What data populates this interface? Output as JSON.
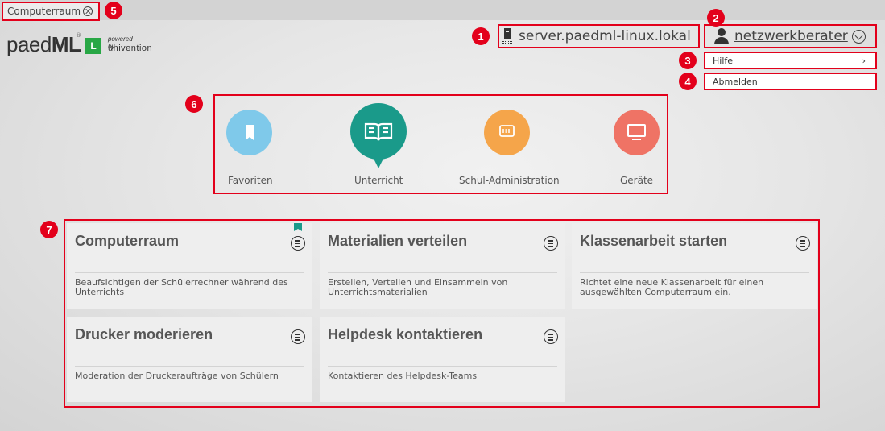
{
  "tab": {
    "label": "Computerraum"
  },
  "annotations": [
    "1",
    "2",
    "3",
    "4",
    "5",
    "6",
    "7"
  ],
  "logo": {
    "name_light": "paed",
    "name_bold": "ML",
    "registered": "®",
    "badge": "L",
    "powered_by": "powered by",
    "vendor": "univention"
  },
  "header": {
    "server": "server.paedml-linux.lokal",
    "user": "netzwerkberater"
  },
  "user_menu": [
    {
      "label": "Hilfe",
      "has_submenu": true
    },
    {
      "label": "Abmelden",
      "has_submenu": false
    }
  ],
  "categories": [
    {
      "label": "Favoriten",
      "color": "#7fc9ea",
      "icon": "bookmark-icon"
    },
    {
      "label": "Unterricht",
      "color": "#1a9a8a",
      "icon": "book-icon",
      "selected": true
    },
    {
      "label": "Schul-Administration",
      "color": "#f5a54a",
      "icon": "calculator-icon"
    },
    {
      "label": "Geräte",
      "color": "#ef7365",
      "icon": "monitor-icon"
    }
  ],
  "modules": [
    {
      "title": "Computerraum",
      "description": "Beaufsichtigen der Schülerrechner während des Unterrichts",
      "favorite": true
    },
    {
      "title": "Materialien verteilen",
      "description": "Erstellen, Verteilen und Einsammeln von Unterrichtsmaterialien"
    },
    {
      "title": "Klassenarbeit starten",
      "description": "Richtet eine neue Klassenarbeit für einen ausgewählten Computerraum ein."
    },
    {
      "title": "Drucker moderieren",
      "description": "Moderation der Druckeraufträge von Schülern"
    },
    {
      "title": "Helpdesk kontaktieren",
      "description": "Kontaktieren des Helpdesk-Teams"
    }
  ]
}
